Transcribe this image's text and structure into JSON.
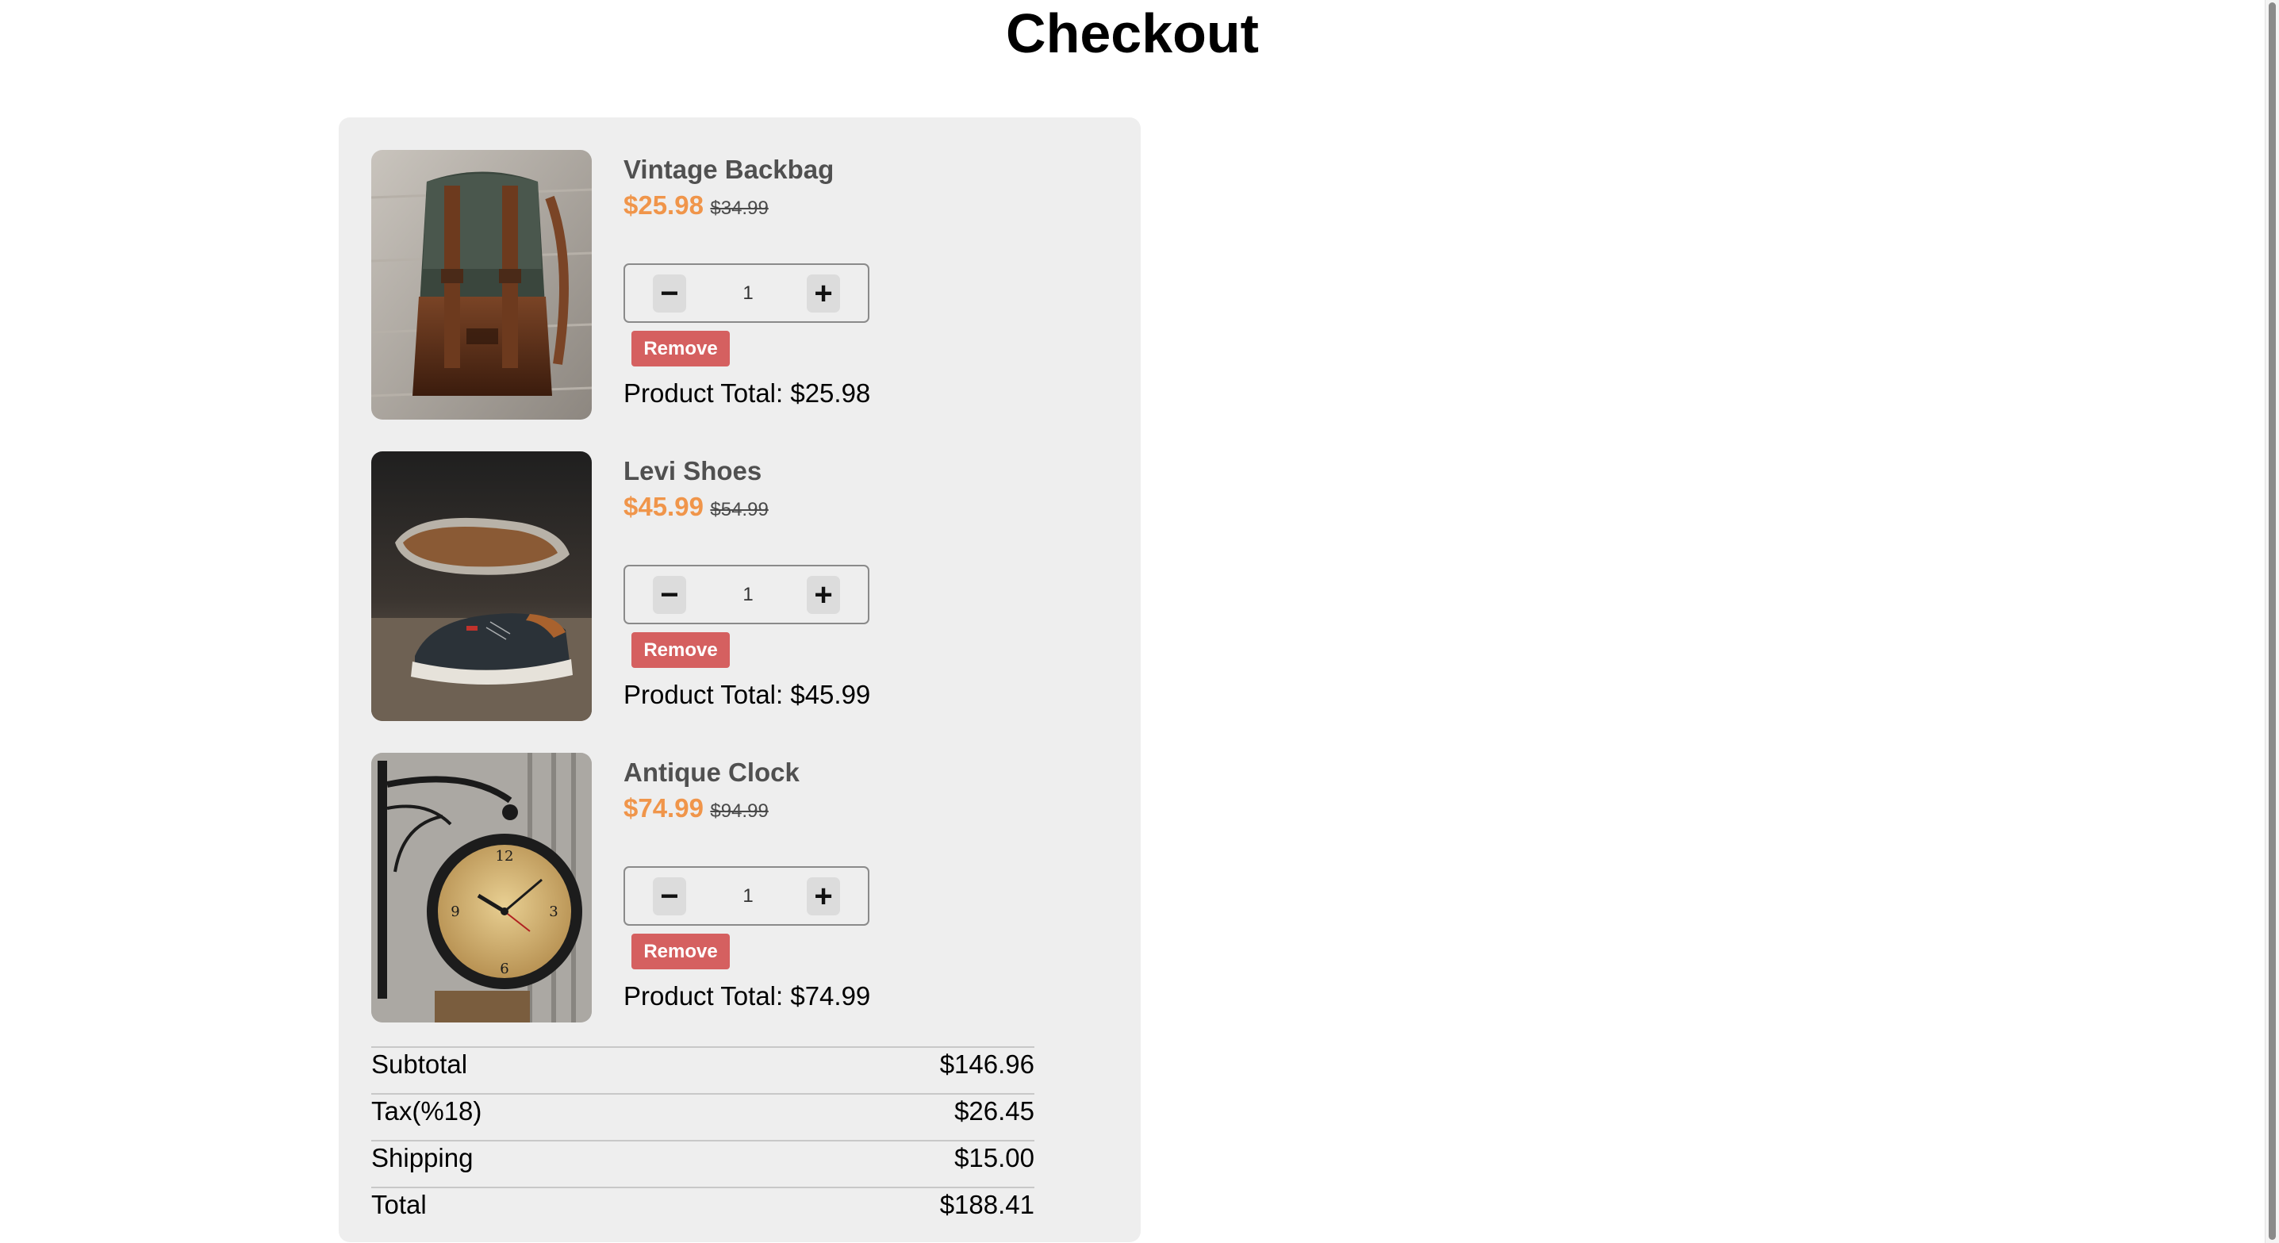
{
  "page": {
    "title": "Checkout"
  },
  "cart": {
    "items": [
      {
        "name": "Vintage Backbag",
        "price": "$25.98",
        "old_price": "$34.99",
        "quantity": "1",
        "remove_label": "Remove",
        "total_label": "Product Total: $25.98",
        "image_icon": "backpack-photo"
      },
      {
        "name": "Levi Shoes",
        "price": "$45.99",
        "old_price": "$54.99",
        "quantity": "1",
        "remove_label": "Remove",
        "total_label": "Product Total: $45.99",
        "image_icon": "shoes-photo"
      },
      {
        "name": "Antique Clock",
        "price": "$74.99",
        "old_price": "$94.99",
        "quantity": "1",
        "remove_label": "Remove",
        "total_label": "Product Total: $74.99",
        "image_icon": "clock-photo"
      }
    ],
    "qty_minus_symbol": "−",
    "qty_plus_symbol": "+"
  },
  "summary": {
    "rows": [
      {
        "label": "Subtotal",
        "value": "$146.96"
      },
      {
        "label": "Tax(%18)",
        "value": "$26.45"
      },
      {
        "label": "Shipping",
        "value": "$15.00"
      },
      {
        "label": "Total",
        "value": "$188.41"
      }
    ]
  },
  "colors": {
    "sale_price": "#f0954a",
    "remove_button": "#d56060",
    "panel_background": "#eeeeee"
  }
}
